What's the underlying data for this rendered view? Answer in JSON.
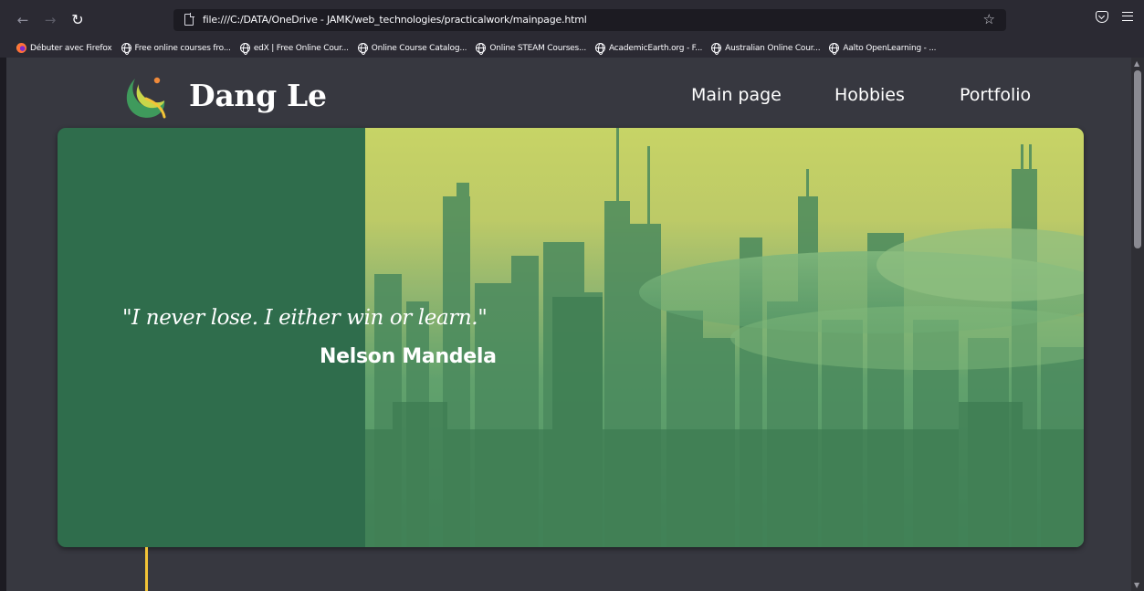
{
  "browser": {
    "url": "file:///C:/DATA/OneDrive - JAMK/web_technologies/practicalwork/mainpage.html",
    "bookmarks": [
      {
        "label": "Débuter avec Firefox",
        "icon": "firefox-icon"
      },
      {
        "label": "Free online courses fro...",
        "icon": "globe-icon"
      },
      {
        "label": "edX | Free Online Cour...",
        "icon": "globe-icon"
      },
      {
        "label": "Online Course Catalog...",
        "icon": "globe-icon"
      },
      {
        "label": "Online STEAM Courses...",
        "icon": "globe-icon"
      },
      {
        "label": "AcademicEarth.org - F...",
        "icon": "globe-icon"
      },
      {
        "label": "Australian Online Cour...",
        "icon": "globe-icon"
      },
      {
        "label": "Aalto OpenLearning - ...",
        "icon": "globe-icon"
      }
    ]
  },
  "site": {
    "brand": "Dang Le",
    "nav": [
      {
        "label": "Main page"
      },
      {
        "label": "Hobbies"
      },
      {
        "label": "Portfolio"
      }
    ],
    "hero": {
      "quote": "\"I never lose. I either win or learn.\"",
      "author": "Nelson Mandela"
    }
  },
  "colors": {
    "hero_green": "#2f6d4c",
    "accent_yellow": "#f3c437",
    "page_background": "#373840"
  }
}
